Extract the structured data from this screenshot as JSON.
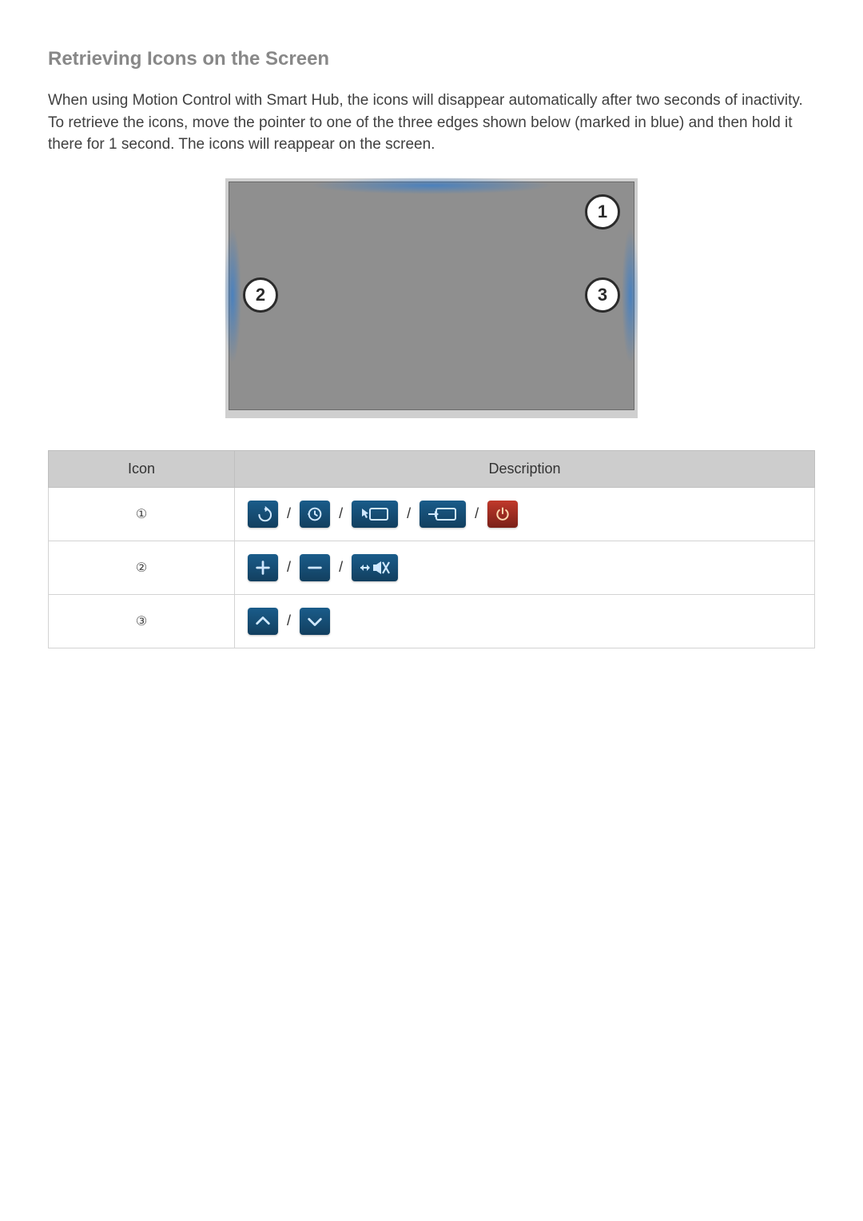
{
  "heading": "Retrieving Icons on the Screen",
  "body_text": "When using Motion Control with Smart Hub, the icons will disappear automatically after two seconds of inactivity. To retrieve the icons, move the pointer to one of the three edges shown below (marked in blue) and then hold it there for 1 second. The icons will reappear on the screen.",
  "callouts": {
    "c1": "1",
    "c2": "2",
    "c3": "3"
  },
  "table": {
    "headers": {
      "icon": "Icon",
      "description": "Description"
    },
    "rows": {
      "r1": "①",
      "r2": "②",
      "r3": "③"
    }
  },
  "sep": "/"
}
